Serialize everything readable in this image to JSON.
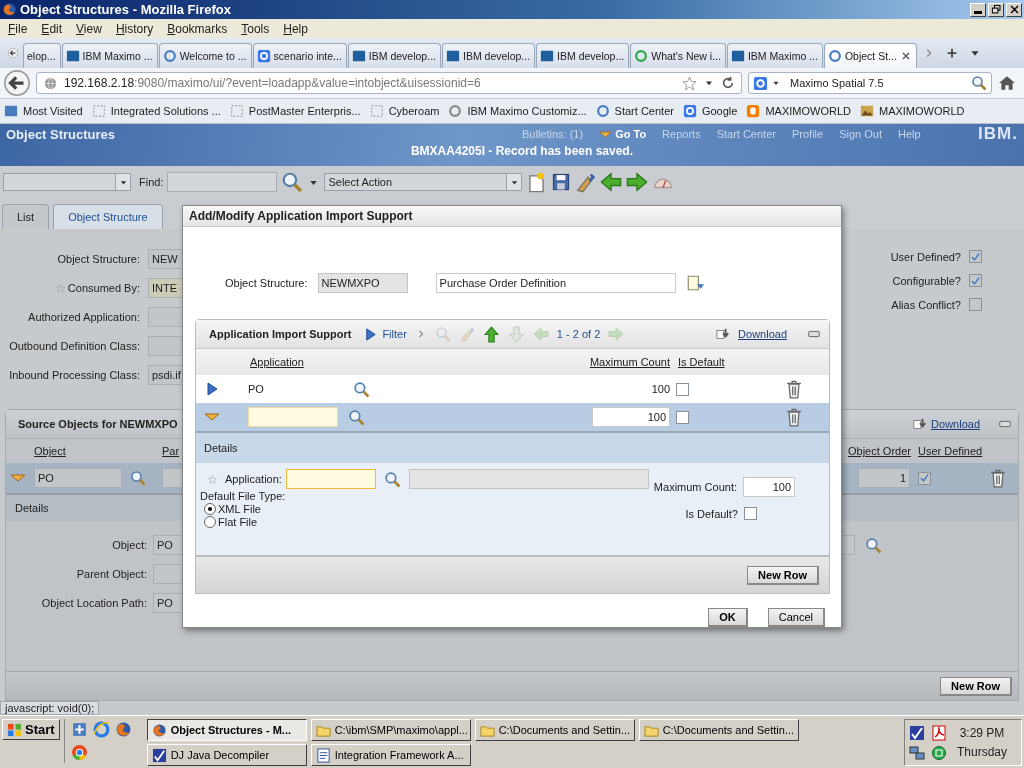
{
  "window": {
    "title": "Object Structures - Mozilla Firefox"
  },
  "menu": [
    "File",
    "Edit",
    "View",
    "History",
    "Bookmarks",
    "Tools",
    "Help"
  ],
  "browser_tabs": [
    {
      "label": "elop...",
      "selected": false
    },
    {
      "label": "IBM Maximo ...",
      "selected": false
    },
    {
      "label": "Welcome to ...",
      "selected": false
    },
    {
      "label": "scenario inte...",
      "selected": false
    },
    {
      "label": "IBM develop...",
      "selected": false
    },
    {
      "label": "IBM develop...",
      "selected": false
    },
    {
      "label": "IBM develop...",
      "selected": false
    },
    {
      "label": "What's New i...",
      "selected": false
    },
    {
      "label": "IBM Maximo ...",
      "selected": false
    },
    {
      "label": "Object St...",
      "selected": true
    }
  ],
  "address_bar": {
    "host": "192.168.2.18",
    "path": ":9080/maximo/ui/?event=loadapp&value=intobject&uisessionid=6"
  },
  "search_box": {
    "value": "Maximo Spatial 7.5"
  },
  "bookmarks": [
    "Most Visited",
    "Integrated Solutions ...",
    "PostMaster Enterpris...",
    "Cyberoam",
    "IBM Maximo Customiz...",
    "Start Center",
    "Google",
    "MAXIMOWORLD",
    "MAXIMOWORLD"
  ],
  "app_header": {
    "title": "Object Structures",
    "links": [
      {
        "label": "Bulletins: (1)",
        "kind": "plain"
      },
      {
        "label": "Go To",
        "kind": "menu"
      },
      {
        "label": "Reports",
        "kind": "plain"
      },
      {
        "label": "Start Center",
        "kind": "plain"
      },
      {
        "label": "Profile",
        "kind": "plain"
      },
      {
        "label": "Sign Out",
        "kind": "plain"
      },
      {
        "label": "Help",
        "kind": "plain"
      }
    ],
    "logo": "IBM.",
    "message": "BMXAA4205I - Record has been saved."
  },
  "toolbar": {
    "find_label": "Find:",
    "action_select": "Select Action"
  },
  "app_tabs": [
    {
      "label": "List",
      "selected": false
    },
    {
      "label": "Object Structure",
      "selected": true
    }
  ],
  "form": {
    "fields": [
      {
        "label": "Object Structure:",
        "value": "NEW",
        "required": false
      },
      {
        "label": "Consumed By:",
        "value": "INTE",
        "required": true
      },
      {
        "label": "Authorized Application:",
        "required": false
      },
      {
        "label": "Outbound Definition Class:",
        "required": false
      },
      {
        "label": "Inbound Processing Class:",
        "value": "psdi.if",
        "required": false
      }
    ],
    "checks": [
      {
        "label": "User Defined?",
        "checked": true
      },
      {
        "label": "Configurable?",
        "checked": true
      },
      {
        "label": "Alias Conflict?",
        "checked": false
      }
    ]
  },
  "source_objects": {
    "title": "Source Objects for NEWMXPO",
    "download": "Download",
    "columns": [
      "Object",
      "Par",
      "Object Order",
      "User Defined"
    ],
    "row": {
      "object": "PO",
      "object_order": "1",
      "user_defined": true
    },
    "details_title": "Details",
    "details_fields": [
      {
        "label": "Object:",
        "value": "PO"
      },
      {
        "label": "Parent Object:"
      },
      {
        "label": "Object Location Path:",
        "value": "PO"
      }
    ],
    "new_row": "New Row"
  },
  "dialog": {
    "title": "Add/Modify Application Import Support",
    "object_structure": {
      "label": "Object Structure:",
      "value": "NEWMXPO",
      "description": "Purchase Order Definition"
    },
    "table": {
      "title": "Application Import Support",
      "filter": "Filter",
      "paging": "1 - 2 of 2",
      "download": "Download",
      "columns": [
        "Application",
        "Maximum Count",
        "Is Default"
      ],
      "rows": [
        {
          "application": "PO",
          "maximum_count": "100",
          "is_default": false,
          "selected": false
        },
        {
          "maximum_count": "100",
          "is_default": false,
          "selected": true
        }
      ]
    },
    "details": {
      "title": "Details",
      "application_label": "Application:",
      "file_type_label": "Default File Type:",
      "file_types": [
        {
          "label": "XML File",
          "selected": true
        },
        {
          "label": "Flat File",
          "selected": false
        }
      ],
      "maximum_count_label": "Maximum Count:",
      "maximum_count": "100",
      "is_default_label": "Is Default?",
      "is_default": false
    },
    "new_row": "New Row",
    "buttons": [
      "OK",
      "Cancel"
    ]
  },
  "status_text": "javascript:  void(0);",
  "taskbar": {
    "start": "Start",
    "tasks": [
      {
        "label": "Object Structures - M...",
        "selected": true
      },
      {
        "label": "C:\\ibm\\SMP\\maximo\\appl...",
        "selected": false
      },
      {
        "label": "C:\\Documents and Settin...",
        "selected": false
      },
      {
        "label": "C:\\Documents and Settin...",
        "selected": false
      },
      {
        "label": "DJ Java Decompiler",
        "selected": false
      },
      {
        "label": "Integration Framework A...",
        "selected": false
      }
    ],
    "clock": "3:29 PM",
    "day": "Thursday"
  }
}
